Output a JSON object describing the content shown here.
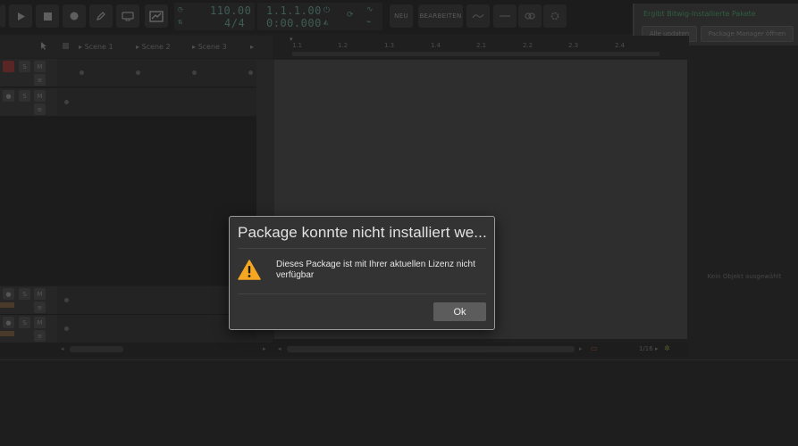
{
  "transport": {
    "tempo": "110.00",
    "time_signature": "4/4",
    "position": "1.1.1.00",
    "time": "0:00.000",
    "new_label": "NEU",
    "edit_label": "BEARBEITEN"
  },
  "notification": {
    "title": "Ergibt Bitwig-Installierte Pakete",
    "update_all_label": "Alle updaten",
    "open_manager_label": "Package Manager öffnen"
  },
  "launcher": {
    "scenes": [
      "Scene 1",
      "Scene 2",
      "Scene 3"
    ],
    "track_buttons": {
      "solo": "S",
      "mute": "M"
    }
  },
  "arrangement": {
    "ruler_marks": [
      "1.1",
      "1.2",
      "1.3",
      "1.4",
      "2.1",
      "2.2",
      "2.3",
      "2.4"
    ],
    "grid_label": "1/16 ▸",
    "no_object_label": "Kein Objekt ausgewählt"
  },
  "dialog": {
    "title": "Package konnte nicht installiert we...",
    "message": "Dieses Package ist mit Ihrer aktuellen Lizenz nicht verfügbar",
    "ok_label": "Ok"
  },
  "colors": {
    "dialog_bg": "#333333",
    "warning": "#f5a623",
    "lcd_text": "#3f5c55",
    "notification_text": "#2f5e3f"
  }
}
